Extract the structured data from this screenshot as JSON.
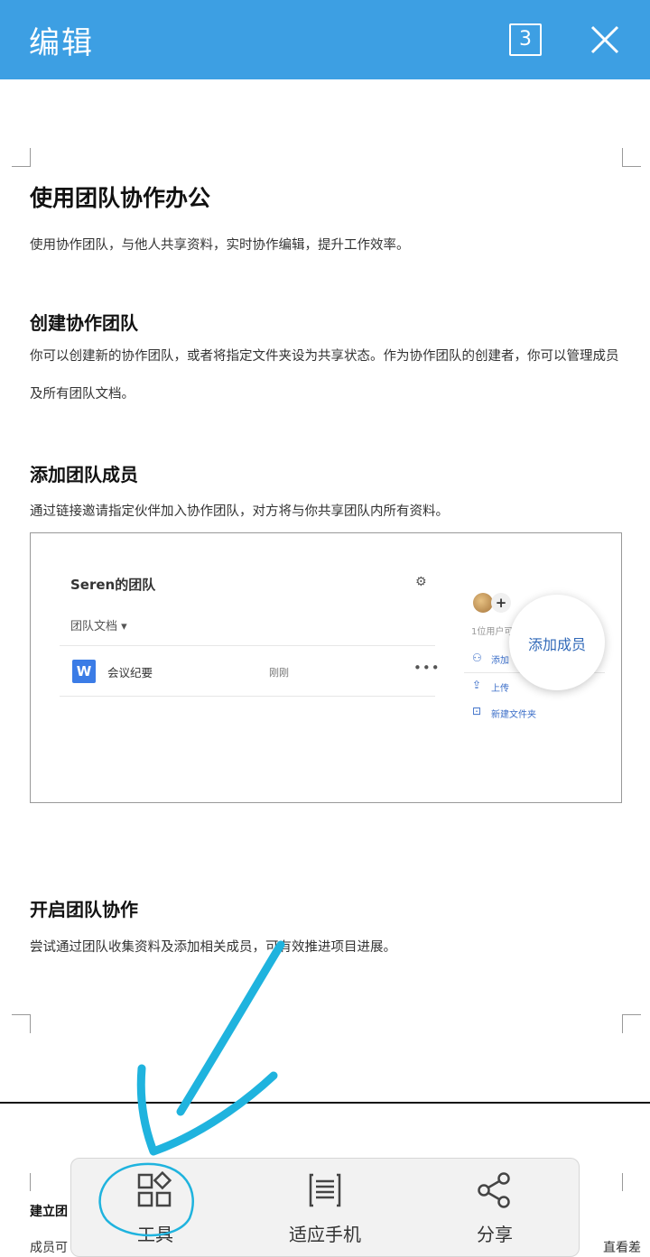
{
  "header": {
    "title": "编辑",
    "page_count": "3"
  },
  "document": {
    "h1": "使用团队协作办公",
    "intro": "使用协作团队，与他人共享资料，实时协作编辑，提升工作效率。",
    "sections": [
      {
        "heading": "创建协作团队",
        "body": "你可以创建新的协作团队，或者将指定文件夹设为共享状态。作为协作团队的创建者，你可以管理成员及所有团队文档。"
      },
      {
        "heading": "添加团队成员",
        "body": "通过链接邀请指定伙伴加入协作团队，对方将与你共享团队内所有资料。"
      },
      {
        "heading": "开启团队协作",
        "body": "尝试通过团队收集资料及添加相关成员，可有效推进项目进展。"
      }
    ],
    "figure": {
      "team_name": "Seren的团队",
      "docs_label": "团队文档 ▾",
      "file_name": "会议纪要",
      "file_time": "刚刚",
      "users_text": "1位用户可",
      "actions": [
        "添加",
        "上传",
        "新建文件夹"
      ],
      "bubble": "添加成员"
    },
    "next_page": {
      "heading": "建立团",
      "line_start": "成员可",
      "line_end": "直看差"
    }
  },
  "toolbar": {
    "items": [
      {
        "label": "工具",
        "icon": "tools-grid-icon"
      },
      {
        "label": "适应手机",
        "icon": "fit-phone-icon"
      },
      {
        "label": "分享",
        "icon": "share-icon"
      }
    ]
  },
  "colors": {
    "header": "#3d9fe3",
    "annotation": "#1fb3de"
  }
}
